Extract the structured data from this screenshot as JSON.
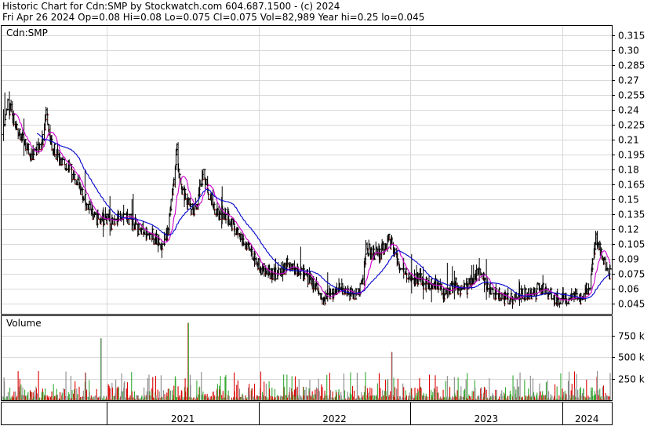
{
  "header": {
    "line1": "Historic Chart for Cdn:SMP by Stockwatch.com 604.687.1500 - (c) 2024",
    "line2": "Fri Apr 26 2024   Op=0.08  Hi=0.08  Lo=0.075  Cl=0.075  Vol=82,989  Year hi=0.25  lo=0.045"
  },
  "symbol": "Cdn:SMP",
  "volume_title": "Volume",
  "colors": {
    "price_bar": "#000000",
    "ma_short": "#cc00cc",
    "ma_long": "#0000cc",
    "vol_up": "#33aa33",
    "vol_down": "#dd0000",
    "vol_flat": "#888888",
    "grid": "#d8d8d8",
    "down_tick": "#dd0000"
  },
  "chart_data": [
    {
      "type": "line",
      "title": "",
      "series": [
        {
          "values": [
            {
              "d": "2020-04-24",
              "c": 0.215
            },
            {
              "d": "2020-05-01",
              "c": 0.235
            },
            {
              "d": "2020-05-08",
              "c": 0.245
            },
            {
              "d": "2020-05-22",
              "c": 0.23
            },
            {
              "d": "2020-06-05",
              "c": 0.215
            },
            {
              "d": "2020-06-19",
              "c": 0.205
            },
            {
              "d": "2020-07-03",
              "c": 0.195
            },
            {
              "d": "2020-07-17",
              "c": 0.2
            },
            {
              "d": "2020-07-31",
              "c": 0.21
            },
            {
              "d": "2020-08-07",
              "c": 0.24
            },
            {
              "d": "2020-08-21",
              "c": 0.2
            },
            {
              "d": "2020-09-11",
              "c": 0.19
            },
            {
              "d": "2020-10-02",
              "c": 0.18
            },
            {
              "d": "2020-10-23",
              "c": 0.165
            },
            {
              "d": "2020-11-13",
              "c": 0.145
            },
            {
              "d": "2020-12-04",
              "c": 0.13
            },
            {
              "d": "2020-12-25",
              "c": 0.13
            },
            {
              "d": "2021-01-15",
              "c": 0.125
            },
            {
              "d": "2021-02-05",
              "c": 0.135
            },
            {
              "d": "2021-02-26",
              "c": 0.13
            },
            {
              "d": "2021-03-19",
              "c": 0.12
            },
            {
              "d": "2021-04-09",
              "c": 0.115
            },
            {
              "d": "2021-04-30",
              "c": 0.11
            },
            {
              "d": "2021-05-14",
              "c": 0.105
            },
            {
              "d": "2021-05-28",
              "c": 0.12
            },
            {
              "d": "2021-06-11",
              "c": 0.17
            },
            {
              "d": "2021-06-18",
              "c": 0.2
            },
            {
              "d": "2021-06-25",
              "c": 0.165
            },
            {
              "d": "2021-07-09",
              "c": 0.15
            },
            {
              "d": "2021-07-23",
              "c": 0.14
            },
            {
              "d": "2021-08-06",
              "c": 0.145
            },
            {
              "d": "2021-08-20",
              "c": 0.18
            },
            {
              "d": "2021-09-03",
              "c": 0.155
            },
            {
              "d": "2021-09-24",
              "c": 0.135
            },
            {
              "d": "2021-10-15",
              "c": 0.135
            },
            {
              "d": "2021-11-05",
              "c": 0.12
            },
            {
              "d": "2021-11-26",
              "c": 0.105
            },
            {
              "d": "2021-12-17",
              "c": 0.095
            },
            {
              "d": "2022-01-07",
              "c": 0.08
            },
            {
              "d": "2022-01-28",
              "c": 0.075
            },
            {
              "d": "2022-02-18",
              "c": 0.075
            },
            {
              "d": "2022-03-11",
              "c": 0.085
            },
            {
              "d": "2022-04-01",
              "c": 0.08
            },
            {
              "d": "2022-04-22",
              "c": 0.075
            },
            {
              "d": "2022-05-13",
              "c": 0.065
            },
            {
              "d": "2022-06-03",
              "c": 0.05
            },
            {
              "d": "2022-06-24",
              "c": 0.055
            },
            {
              "d": "2022-07-15",
              "c": 0.06
            },
            {
              "d": "2022-08-05",
              "c": 0.055
            },
            {
              "d": "2022-08-26",
              "c": 0.055
            },
            {
              "d": "2022-09-09",
              "c": 0.07
            },
            {
              "d": "2022-09-16",
              "c": 0.1
            },
            {
              "d": "2022-09-30",
              "c": 0.095
            },
            {
              "d": "2022-10-14",
              "c": 0.095
            },
            {
              "d": "2022-10-28",
              "c": 0.1
            },
            {
              "d": "2022-11-11",
              "c": 0.11
            },
            {
              "d": "2022-11-25",
              "c": 0.095
            },
            {
              "d": "2022-12-09",
              "c": 0.08
            },
            {
              "d": "2022-12-30",
              "c": 0.07
            },
            {
              "d": "2023-01-20",
              "c": 0.07
            },
            {
              "d": "2023-02-10",
              "c": 0.065
            },
            {
              "d": "2023-03-03",
              "c": 0.065
            },
            {
              "d": "2023-03-24",
              "c": 0.055
            },
            {
              "d": "2023-04-14",
              "c": 0.065
            },
            {
              "d": "2023-05-05",
              "c": 0.06
            },
            {
              "d": "2023-05-26",
              "c": 0.065
            },
            {
              "d": "2023-06-16",
              "c": 0.08
            },
            {
              "d": "2023-07-07",
              "c": 0.06
            },
            {
              "d": "2023-07-28",
              "c": 0.055
            },
            {
              "d": "2023-08-18",
              "c": 0.05
            },
            {
              "d": "2023-09-08",
              "c": 0.05
            },
            {
              "d": "2023-09-29",
              "c": 0.055
            },
            {
              "d": "2023-10-20",
              "c": 0.055
            },
            {
              "d": "2023-11-10",
              "c": 0.06
            },
            {
              "d": "2023-12-01",
              "c": 0.055
            },
            {
              "d": "2023-12-22",
              "c": 0.05
            },
            {
              "d": "2024-01-12",
              "c": 0.05
            },
            {
              "d": "2024-02-02",
              "c": 0.05
            },
            {
              "d": "2024-02-23",
              "c": 0.055
            },
            {
              "d": "2024-03-08",
              "c": 0.065
            },
            {
              "d": "2024-03-22",
              "c": 0.11
            },
            {
              "d": "2024-04-05",
              "c": 0.095
            },
            {
              "d": "2024-04-19",
              "c": 0.08
            },
            {
              "d": "2024-04-26",
              "c": 0.075
            }
          ]
        }
      ],
      "x_range": [
        "2020-04-24",
        "2024-04-26"
      ],
      "ylim": [
        0.035,
        0.325
      ],
      "yticks": [
        0.315,
        0.3,
        0.285,
        0.27,
        0.255,
        0.24,
        0.225,
        0.21,
        0.195,
        0.18,
        0.165,
        0.15,
        0.135,
        0.12,
        0.105,
        0.09,
        0.075,
        0.06,
        0.045
      ],
      "ytick_labels": [
        "0.315",
        "0.30",
        "0.285",
        "0.27",
        "0.255",
        "0.24",
        "0.225",
        "0.21",
        "0.195",
        "0.18",
        "0.165",
        "0.15",
        "0.135",
        "0.12",
        "0.105",
        "0.09",
        "0.075",
        "0.06",
        "0.045"
      ],
      "grid": true,
      "moving_averages": true
    },
    {
      "type": "bar",
      "title": "Volume",
      "yticks": [
        250000,
        500000,
        750000
      ],
      "ytick_labels": [
        "250 k",
        "500 k",
        "750 k"
      ],
      "ylim": [
        0,
        950000
      ],
      "highlights": [
        {
          "d": "2020-12-18",
          "v": 720000
        },
        {
          "d": "2021-07-16",
          "v": 900000
        },
        {
          "d": "2022-11-18",
          "v": 560000
        }
      ]
    }
  ],
  "x_axis": {
    "years": [
      "2021",
      "2022",
      "2023",
      "2024"
    ],
    "year_starts": [
      "2021-01-01",
      "2022-01-01",
      "2023-01-01",
      "2024-01-01"
    ]
  }
}
